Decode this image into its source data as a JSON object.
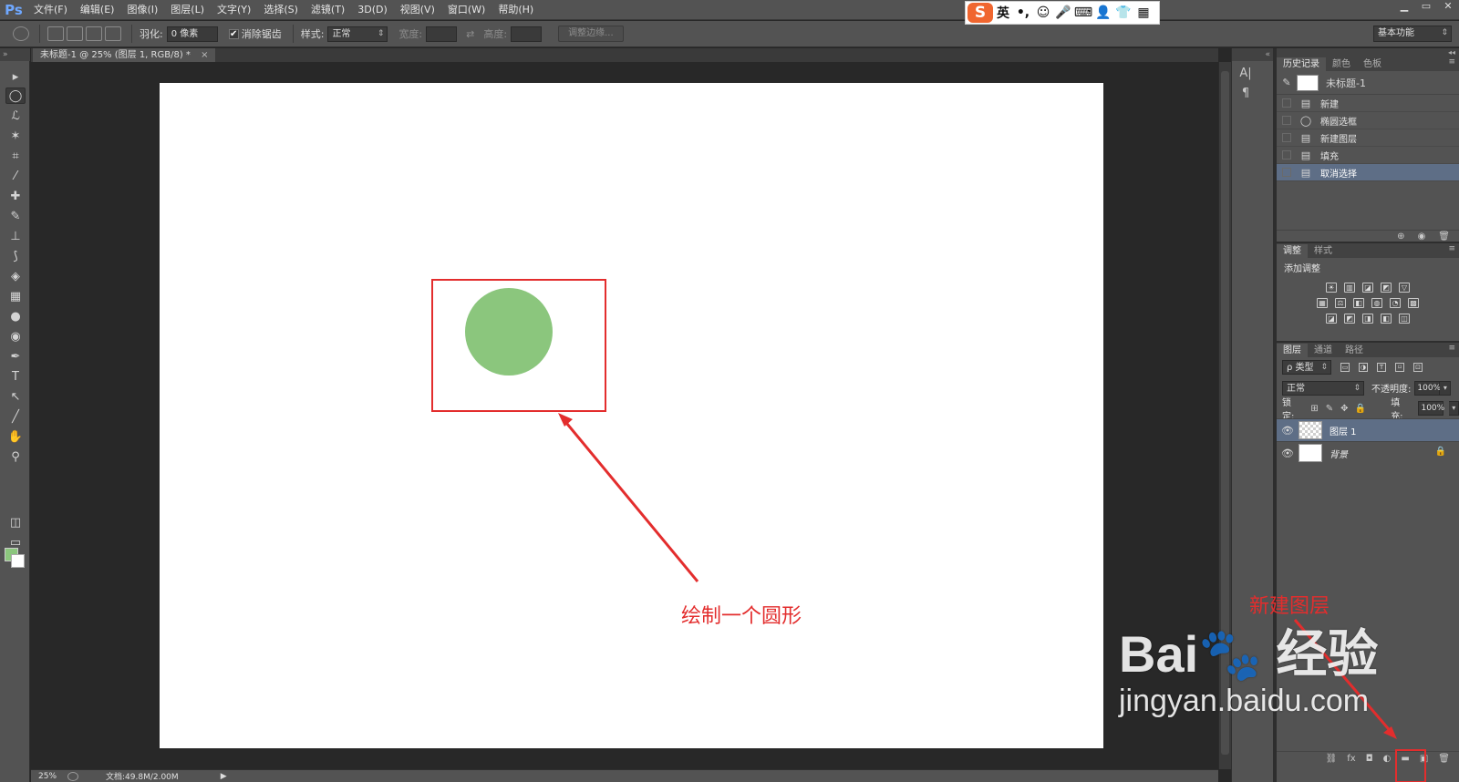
{
  "app": {
    "logo": "Ps",
    "menu": [
      "文件(F)",
      "编辑(E)",
      "图像(I)",
      "图层(L)",
      "文字(Y)",
      "选择(S)",
      "滤镜(T)",
      "3D(D)",
      "视图(V)",
      "窗口(W)",
      "帮助(H)"
    ],
    "ime": {
      "logo": "S",
      "mode": "英",
      "punct": "•,",
      "emoji": "☺",
      "mic": "🎤",
      "keyboard": "⌨",
      "user": "👤",
      "skin": "👕",
      "apps": "▦"
    },
    "window_controls": [
      "▁",
      "▭",
      "✕"
    ]
  },
  "options": {
    "feather_label": "羽化:",
    "feather_value": "0 像素",
    "antialias_checked": "✔",
    "antialias_label": "消除锯齿",
    "style_label": "样式:",
    "style_value": "正常",
    "width_label": "宽度:",
    "swap_icon": "⇄",
    "height_label": "高度:",
    "refine_edge": "调整边缘...",
    "workspace": "基本功能"
  },
  "document": {
    "tab_title": "未标题-1 @ 25% (图层 1, RGB/8) *",
    "tab_close": "×",
    "zoom": "25%",
    "doc_info": "文档:49.8M/2.00M",
    "status_arrow": "▶"
  },
  "tools": {
    "header": "»",
    "icons": [
      "▸",
      "◯",
      "ℒ",
      "✶",
      "⌗",
      "⁄",
      "✚",
      "✎",
      "⊥",
      "⟆",
      "◈",
      "▦",
      "●",
      "◉",
      "✒",
      "T",
      "↖",
      "╱",
      "✋",
      "⚲",
      "◫",
      "▭"
    ],
    "fg_color": "#8bc67d",
    "bg_color": "#ffffff"
  },
  "dock": {
    "header": "«",
    "icons": [
      "A|",
      "¶"
    ]
  },
  "history": {
    "tabs": [
      "历史记录",
      "颜色",
      "色板"
    ],
    "menu_icon": "≡",
    "brush_icon": "✎",
    "snapshot": "未标题-1",
    "rows": [
      {
        "icon": "▤",
        "label": "新建"
      },
      {
        "icon": "◯",
        "label": "椭圆选框"
      },
      {
        "icon": "▤",
        "label": "新建图层"
      },
      {
        "icon": "▤",
        "label": "填充"
      },
      {
        "icon": "▤",
        "label": "取消选择"
      }
    ],
    "footer_icons": [
      "⊕",
      "◉",
      "🗑"
    ]
  },
  "adjustments": {
    "tabs": [
      "调整",
      "样式"
    ],
    "menu_icon": "≡",
    "title": "添加调整",
    "row1": [
      "☀",
      "▥",
      "◪",
      "◩",
      "▽"
    ],
    "row2": [
      "▦",
      "⚖",
      "◧",
      "◍",
      "◔",
      "▩"
    ],
    "row3": [
      "◪",
      "◩",
      "◨",
      "◧",
      "◫"
    ]
  },
  "layers": {
    "tabs": [
      "图层",
      "通道",
      "路径"
    ],
    "menu_icon": "≡",
    "filter_kind": "ρ 类型",
    "filter_icons": [
      "▭",
      "◑",
      "T",
      "⌑",
      "⊡"
    ],
    "blend_mode": "正常",
    "opacity_label": "不透明度:",
    "opacity": "100%",
    "lock_label": "锁定:",
    "lock_icons": [
      "⊞",
      "✎",
      "✥",
      "🔒"
    ],
    "fill_label": "填充:",
    "fill": "100%",
    "dropdown_icon": "▾",
    "eye_icon": "👁",
    "items": [
      {
        "name": "图层 1"
      },
      {
        "name": "背景",
        "lock": "🔒"
      }
    ],
    "footer_icons": [
      "⛓",
      "fx",
      "◘",
      "◐",
      "▬",
      "▣",
      "🗑"
    ]
  },
  "annotations": {
    "circle_label": "绘制一个圆形",
    "new_layer_label": "新建图层",
    "color": "#e32d2d",
    "circle_color": "#8bc67d"
  },
  "watermark": {
    "main": "Bai🐾 经验",
    "url": "jingyan.baidu.com"
  }
}
